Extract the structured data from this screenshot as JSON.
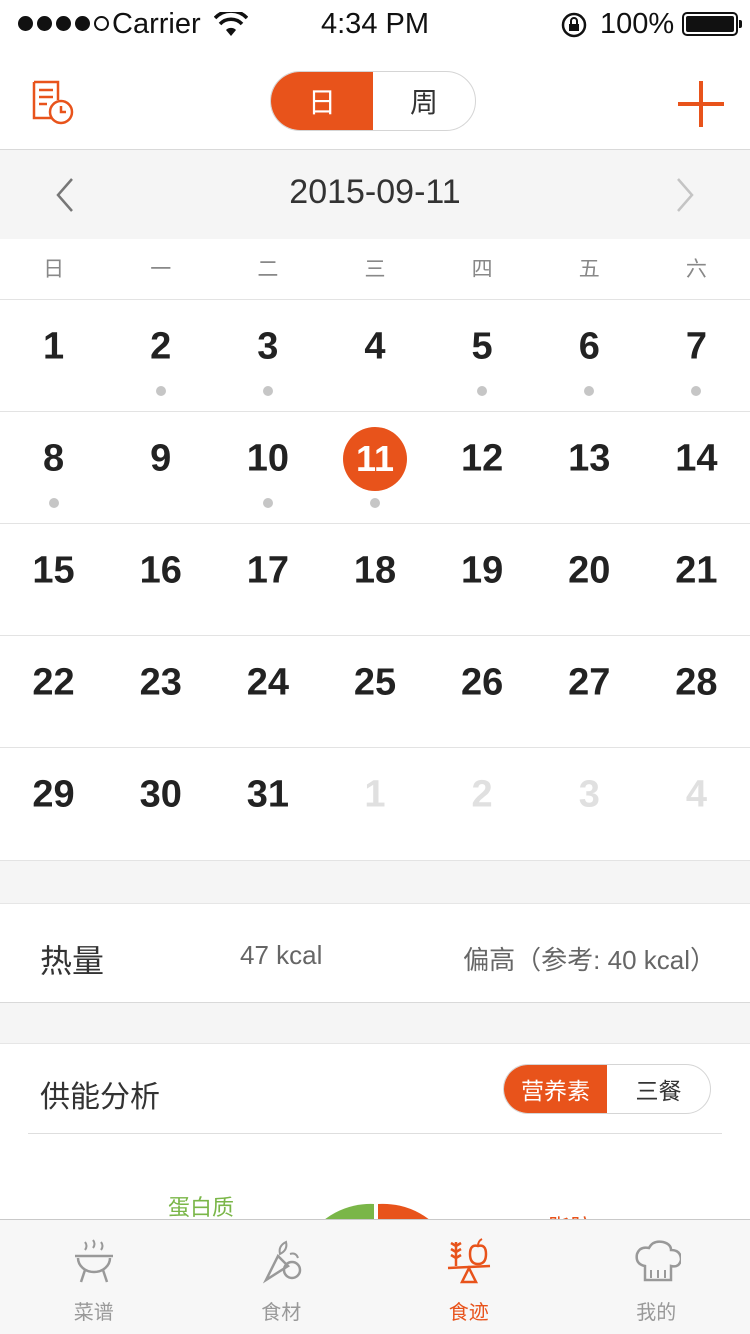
{
  "status_bar": {
    "carrier": "Carrier",
    "time": "4:34 PM",
    "battery": "100%"
  },
  "nav": {
    "left_icon": "diet-log-history-icon",
    "segments": [
      {
        "label": "日",
        "active": true
      },
      {
        "label": "周",
        "active": false
      }
    ],
    "right_icon": "plus-icon"
  },
  "date_header": {
    "title": "2015-09-11",
    "prev_icon": "chevron-left-icon",
    "next_icon": "chevron-right-icon"
  },
  "weekdays": [
    "日",
    "一",
    "二",
    "三",
    "四",
    "五",
    "六"
  ],
  "calendar": [
    [
      {
        "day": "1"
      },
      {
        "day": "2",
        "dot": true
      },
      {
        "day": "3",
        "dot": true
      },
      {
        "day": "4"
      },
      {
        "day": "5",
        "dot": true
      },
      {
        "day": "6",
        "dot": true
      },
      {
        "day": "7",
        "dot": true
      }
    ],
    [
      {
        "day": "8",
        "dot": true
      },
      {
        "day": "9"
      },
      {
        "day": "10",
        "dot": true
      },
      {
        "day": "11",
        "dot": true,
        "selected": true
      },
      {
        "day": "12"
      },
      {
        "day": "13"
      },
      {
        "day": "14"
      }
    ],
    [
      {
        "day": "15"
      },
      {
        "day": "16"
      },
      {
        "day": "17"
      },
      {
        "day": "18"
      },
      {
        "day": "19"
      },
      {
        "day": "20"
      },
      {
        "day": "21"
      }
    ],
    [
      {
        "day": "22"
      },
      {
        "day": "23"
      },
      {
        "day": "24"
      },
      {
        "day": "25"
      },
      {
        "day": "26"
      },
      {
        "day": "27"
      },
      {
        "day": "28"
      }
    ],
    [
      {
        "day": "29"
      },
      {
        "day": "30"
      },
      {
        "day": "31"
      },
      {
        "day": "1",
        "muted": true
      },
      {
        "day": "2",
        "muted": true
      },
      {
        "day": "3",
        "muted": true
      },
      {
        "day": "4",
        "muted": true
      }
    ]
  ],
  "calories": {
    "label": "热量",
    "value": "47 kcal",
    "reference": "偏高（参考: 40 kcal）"
  },
  "energy_analysis": {
    "title": "供能分析",
    "toggle": [
      {
        "label": "营养素",
        "active": true
      },
      {
        "label": "三餐",
        "active": false
      }
    ],
    "protein_label": "蛋白质",
    "fat_label": "脂肪",
    "colors": {
      "protein": "#7ab648",
      "fat": "#e8531b"
    }
  },
  "tab_bar": [
    {
      "label": "菜谱",
      "icon": "grill-icon",
      "active": false
    },
    {
      "label": "食材",
      "icon": "vegetables-icon",
      "active": false
    },
    {
      "label": "食迹",
      "icon": "wheat-apple-scale-icon",
      "active": true
    },
    {
      "label": "我的",
      "icon": "chef-hat-icon",
      "active": false
    }
  ],
  "accent_color": "#e8531b"
}
